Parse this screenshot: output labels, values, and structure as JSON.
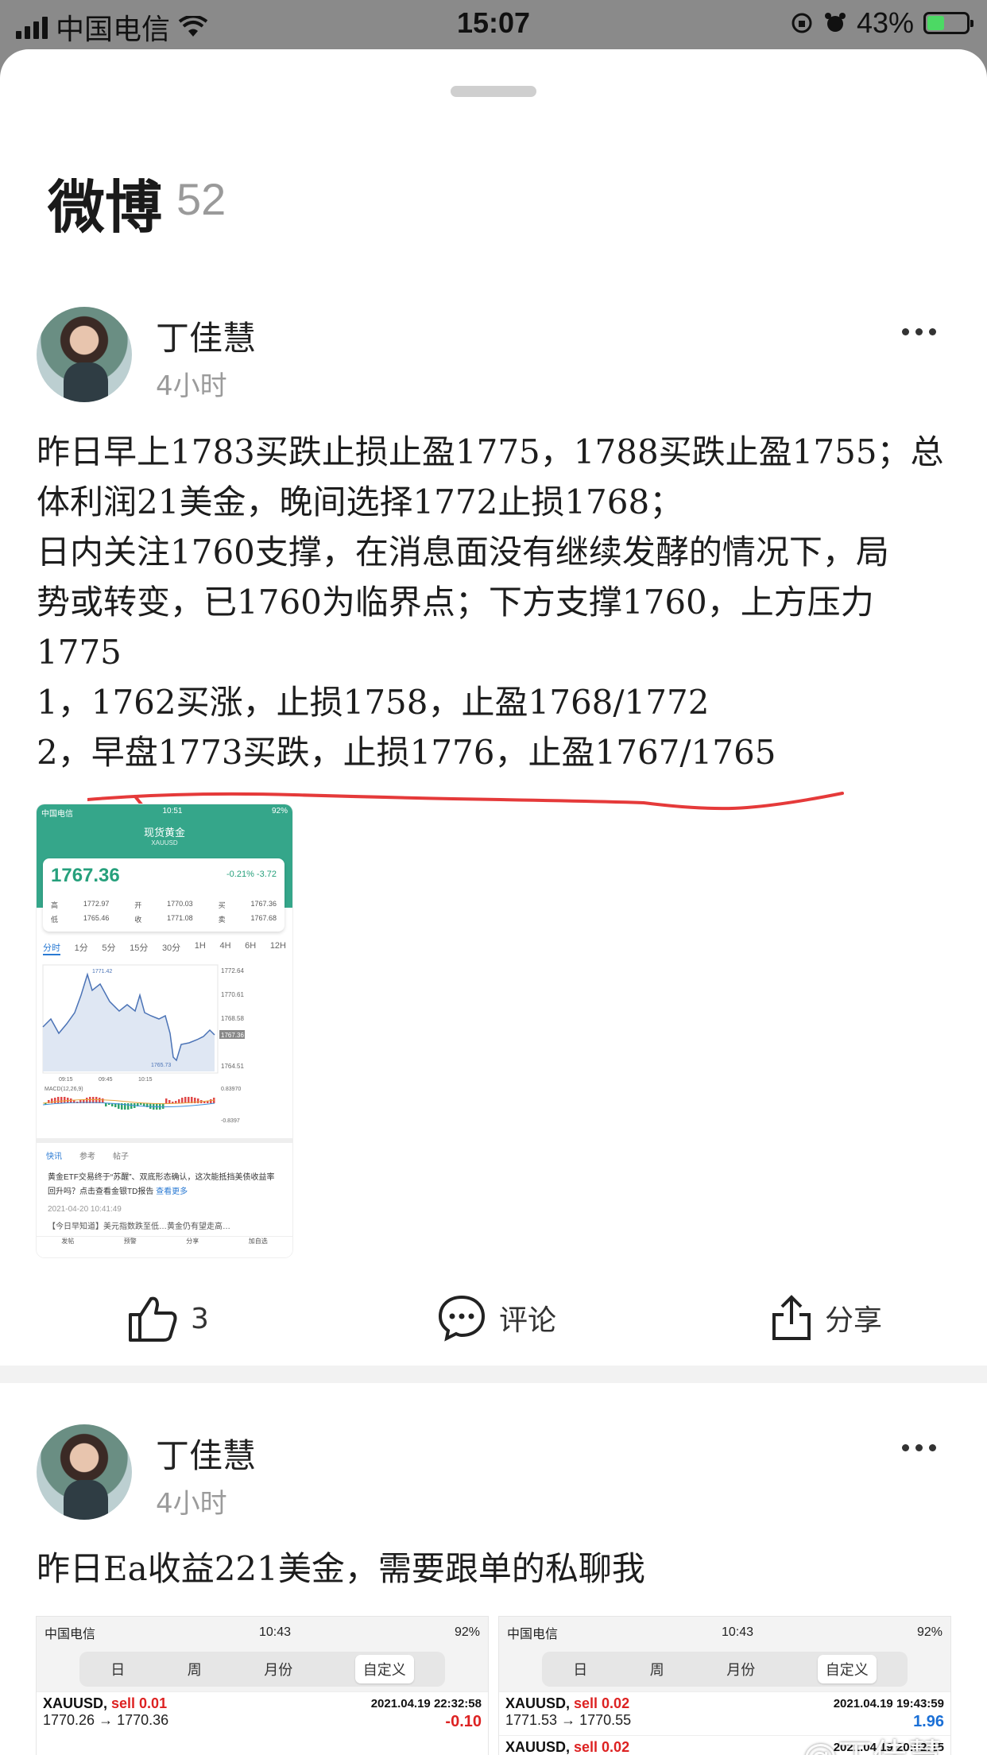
{
  "status_bar": {
    "carrier": "中国电信",
    "time": "15:07",
    "battery_percent": "43%",
    "battery_level": 0.43
  },
  "header": {
    "title": "微博",
    "count": "52"
  },
  "posts": [
    {
      "author": "丁佳慧",
      "time": "4小时",
      "lines": [
        "昨日早上1783买跌止损止盈1775，1788买跌止盈1755；总",
        "体利润21美金，晚间选择1772止损1768；",
        "日内关注1760支撑，在消息面没有继续发酵的情况下，局",
        "势或转变，已1760为临界点；下方支撑1760，上方压力",
        "1775",
        "1，1762买涨，止损1758，止盈1768/1772",
        "2，早盘1773买跌，止损1776，止盈1767/1765"
      ],
      "image": {
        "status_time": "10:51",
        "status_carrier": "中国电信",
        "status_battery": "92%",
        "title": "现货黄金",
        "subtitle": "XAUUSD",
        "price": "1767.36",
        "change_pct": "-0.21%",
        "change": "-3.72",
        "stats_row1": [
          "高",
          "1772.97",
          "开",
          "1770.03",
          "买",
          "1767.36"
        ],
        "stats_row2": [
          "低",
          "1765.46",
          "收",
          "1771.08",
          "卖",
          "1767.68"
        ],
        "tabs": [
          "分时",
          "1分",
          "5分",
          "15分",
          "30分",
          "1H",
          "4H",
          "6H",
          "12H"
        ],
        "y_ticks": [
          "1772.64",
          "1770.61",
          "1768.58",
          "1767.36",
          "1764.51"
        ],
        "x_ticks": [
          "09:15",
          "09:45",
          "10:15"
        ],
        "peak_label": "1771.42",
        "low_label": "1765.73",
        "macd_label": "MACD(12,26,9)",
        "macd_ticks": [
          "0.83970",
          "-0.8397"
        ],
        "news_tabs": [
          "快讯",
          "参考",
          "帖子"
        ],
        "news_text": "黄金ETF交易终于“苏醒”、双底形态确认，这次能抵挡美债收益率回升吗？点击查看金银TD报告",
        "news_link": "查看更多",
        "news_time": "2021-04-20 10:41:49",
        "news_text2": "【今日早知道】美元指数跌至低…黄金仍有望走高…",
        "footer": [
          "发帖",
          "预警",
          "分享",
          "加自选"
        ]
      },
      "likes": "3",
      "comment_label": "评论",
      "share_label": "分享"
    },
    {
      "author": "丁佳慧",
      "time": "4小时",
      "text": "昨日Ea收益221美金，需要跟单的私聊我",
      "shots": [
        {
          "carrier": "中国电信",
          "time": "10:43",
          "battery": "92%",
          "segments": [
            "日",
            "周",
            "月份",
            "自定义"
          ],
          "rows": [
            {
              "symbol": "XAUUSD,",
              "side": "sell 0.01",
              "date": "2021.04.19 22:32:58",
              "move": "1770.26 → 1770.36",
              "pl": "-0.10",
              "pl_color": "#d22"
            }
          ]
        },
        {
          "carrier": "中国电信",
          "time": "10:43",
          "battery": "92%",
          "segments": [
            "日",
            "周",
            "月份",
            "自定义"
          ],
          "rows": [
            {
              "symbol": "XAUUSD,",
              "side": "sell 0.02",
              "date": "2021.04.19 19:43:59",
              "move": "1771.53 → 1770.55",
              "pl": "1.96",
              "pl_color": "#1a6fd6"
            },
            {
              "symbol": "XAUUSD,",
              "side": "sell 0.02",
              "date": "2021.04.19 20:02:15",
              "move": "",
              "pl": "",
              "pl_color": "#1a6fd6"
            }
          ]
        }
      ]
    }
  ],
  "watermark": "@丁佳慧",
  "colors": {
    "accent_green": "#35a68a",
    "sell_red": "#d22",
    "underline_red": "#e53a3a"
  }
}
